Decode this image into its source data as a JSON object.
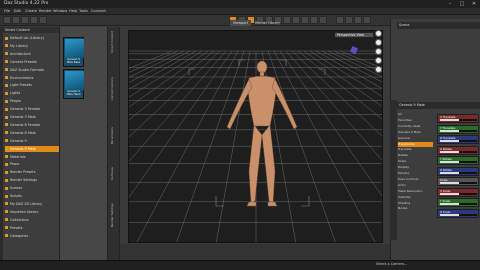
{
  "window": {
    "title": "Daz Studio 4.22 Pro",
    "min": "–",
    "max": "□",
    "close": "✕"
  },
  "menus": [
    "File",
    "Edit",
    "Create",
    "Render",
    "Window",
    "Help",
    "Tools",
    "Connect"
  ],
  "left_panel": {
    "header": "Smart Content",
    "items": [
      {
        "label": "Default Lib (Library)",
        "sel": false
      },
      {
        "label": "My Library",
        "sel": false
      },
      {
        "label": "Architecture",
        "sel": false
      },
      {
        "label": "Camera Presets",
        "sel": false
      },
      {
        "label": "DAZ Studio Formats",
        "sel": false
      },
      {
        "label": "Environments",
        "sel": false
      },
      {
        "label": "Light Presets",
        "sel": false
      },
      {
        "label": "Lights",
        "sel": false
      },
      {
        "label": "People",
        "sel": false
      },
      {
        "label": "Genesis 3 Female",
        "sel": false
      },
      {
        "label": "Genesis 3 Male",
        "sel": false
      },
      {
        "label": "Genesis 8 Female",
        "sel": false
      },
      {
        "label": "Genesis 8 Male",
        "sel": false
      },
      {
        "label": "Genesis 9",
        "sel": false
      },
      {
        "label": "Genesis 9 Male",
        "sel": true
      },
      {
        "label": "Materials",
        "sel": false
      },
      {
        "label": "Props",
        "sel": false
      },
      {
        "label": "Render Presets",
        "sel": false
      },
      {
        "label": "Render Settings",
        "sel": false
      },
      {
        "label": "Scenes",
        "sel": false
      },
      {
        "label": "Scripts",
        "sel": false
      },
      {
        "label": "My DAZ 3D Library",
        "sel": false
      },
      {
        "label": "Imported Library",
        "sel": false
      },
      {
        "label": "Collections",
        "sel": false
      },
      {
        "label": "Presets",
        "sel": false
      },
      {
        "label": "Categories",
        "sel": false
      }
    ]
  },
  "thumbs": [
    {
      "caption": "Genesis 9 Male Base"
    },
    {
      "caption": "Genesis 9 Male Head"
    }
  ],
  "side_tabs": [
    "Smart Content",
    "Content Library",
    "Parameters",
    "Surfaces",
    "Render Settings"
  ],
  "viewport": {
    "tabs": [
      {
        "label": "Viewport",
        "on": true
      },
      {
        "label": "Render Library",
        "on": false
      }
    ],
    "camera": "Perspective View",
    "axis_label": "Z",
    "colors": {
      "floor": "#1e1e1e",
      "grid": "#6a6a6a",
      "skin": "#c8916c"
    }
  },
  "right_panel": {
    "top_header": "Scene",
    "list_header": "Genesis 9 Male",
    "tree": [
      {
        "label": "All",
        "sel": false
      },
      {
        "label": "Favorites",
        "sel": false
      },
      {
        "label": "Currently Used",
        "sel": false
      },
      {
        "label": "Genesis 9 Male",
        "sel": false
      },
      {
        "label": "General",
        "sel": false
      },
      {
        "label": "Transforms",
        "sel": true
      },
      {
        "label": "Translate",
        "sel": false
      },
      {
        "label": "Rotate",
        "sel": false
      },
      {
        "label": "Scale",
        "sel": false
      },
      {
        "label": "Display",
        "sel": false
      },
      {
        "label": "Morphs",
        "sel": false
      },
      {
        "label": "Pose Controls",
        "sel": false
      },
      {
        "label": "Actor",
        "sel": false
      },
      {
        "label": "Mesh Resolution",
        "sel": false
      },
      {
        "label": "Visibility",
        "sel": false
      },
      {
        "label": "Shading",
        "sel": false
      },
      {
        "label": "Nodes",
        "sel": false
      }
    ],
    "sliders": [
      {
        "label": "X Translate",
        "fill": 0.5,
        "color": "#7a2a2a"
      },
      {
        "label": "Y Translate",
        "fill": 0.5,
        "color": "#2a6a2a"
      },
      {
        "label": "Z Translate",
        "fill": 0.5,
        "color": "#2a3a7a"
      },
      {
        "label": "X Rotate",
        "fill": 0.5,
        "color": "#7a2a2a"
      },
      {
        "label": "Y Rotate",
        "fill": 0.5,
        "color": "#2a6a2a"
      },
      {
        "label": "Z Rotate",
        "fill": 0.5,
        "color": "#2a3a7a"
      },
      {
        "label": "Scale",
        "fill": 0.5,
        "color": "#555555"
      },
      {
        "label": "X Scale",
        "fill": 0.5,
        "color": "#7a2a2a"
      },
      {
        "label": "Y Scale",
        "fill": 0.5,
        "color": "#2a6a2a"
      },
      {
        "label": "Z Scale",
        "fill": 0.5,
        "color": "#2a3a7a"
      }
    ]
  },
  "status": {
    "text": "Select a Camera..."
  },
  "accent": "#e08a1a"
}
